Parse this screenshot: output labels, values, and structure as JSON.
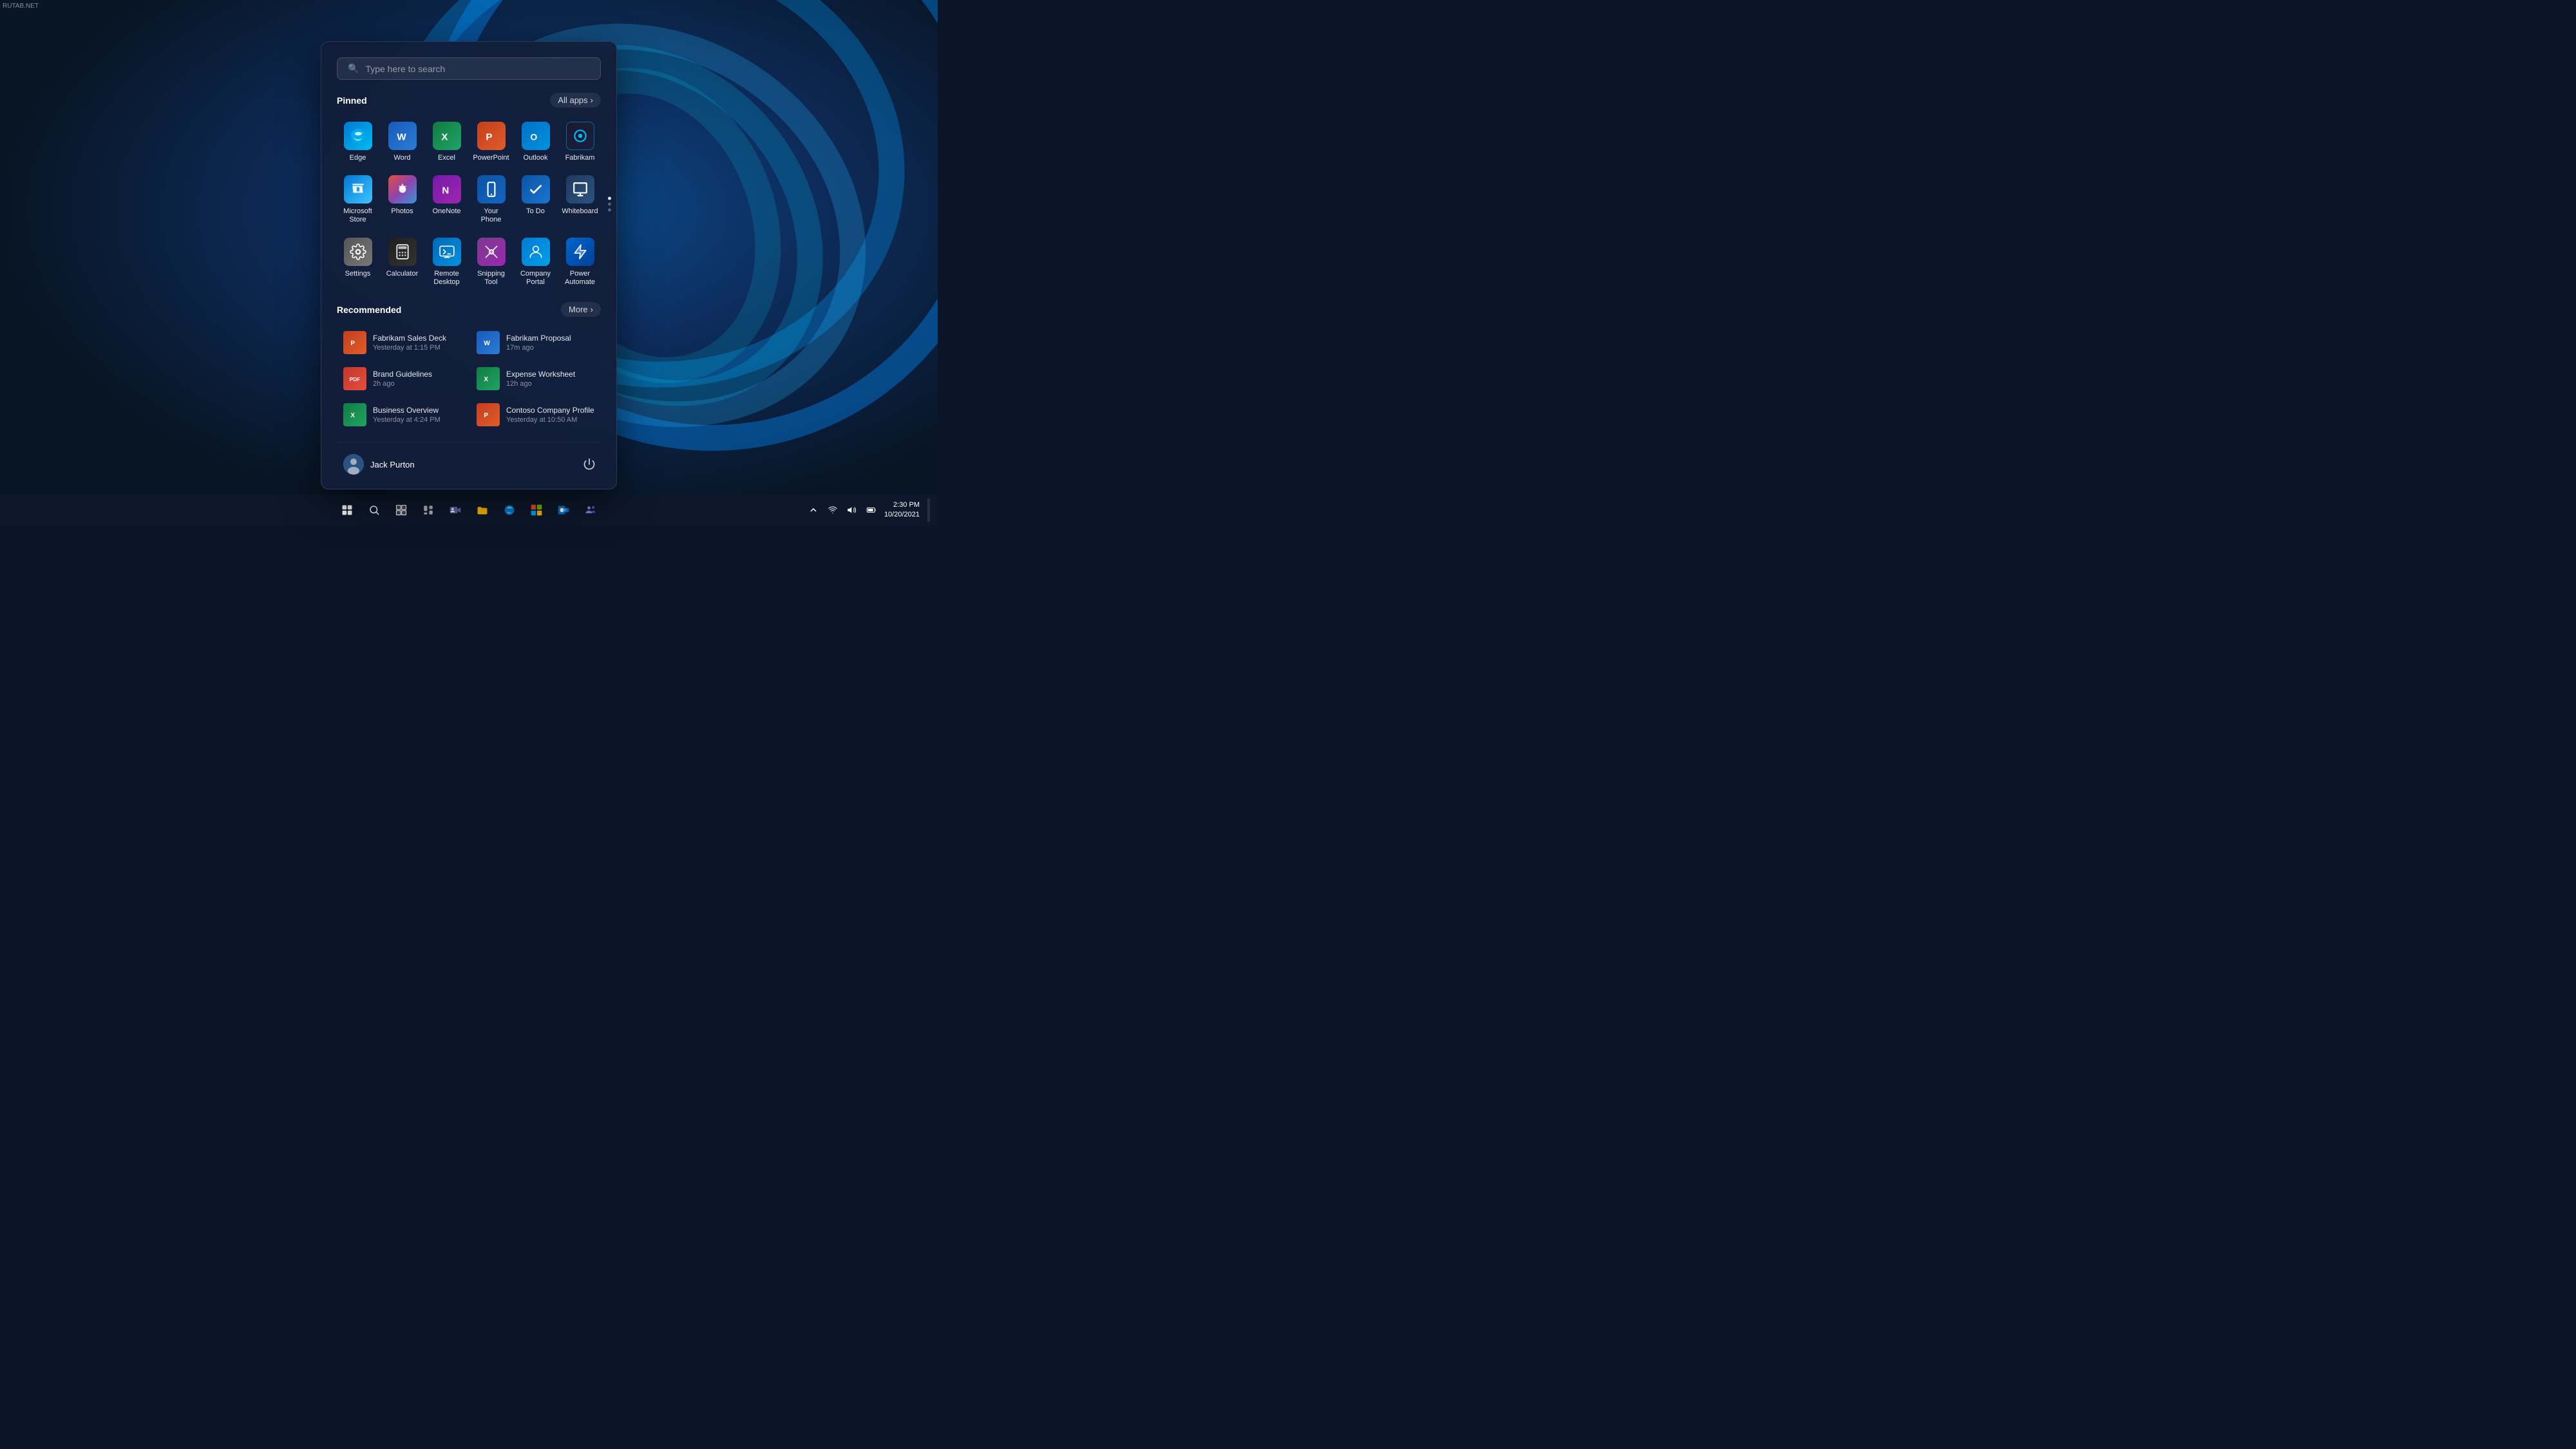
{
  "watermark": "RUTAB.NET",
  "wallpaper": {
    "description": "Windows 11 blue ribbon wallpaper"
  },
  "start_menu": {
    "search": {
      "placeholder": "Type here to search"
    },
    "pinned": {
      "label": "Pinned",
      "all_apps_label": "All apps",
      "apps": [
        {
          "id": "edge",
          "label": "Edge",
          "icon_type": "edge"
        },
        {
          "id": "word",
          "label": "Word",
          "icon_type": "word"
        },
        {
          "id": "excel",
          "label": "Excel",
          "icon_type": "excel"
        },
        {
          "id": "powerpoint",
          "label": "PowerPoint",
          "icon_type": "powerpoint"
        },
        {
          "id": "outlook",
          "label": "Outlook",
          "icon_type": "outlook"
        },
        {
          "id": "fabrikam",
          "label": "Fabrikam",
          "icon_type": "fabrikam"
        },
        {
          "id": "msstore",
          "label": "Microsoft Store",
          "icon_type": "store"
        },
        {
          "id": "photos",
          "label": "Photos",
          "icon_type": "photos"
        },
        {
          "id": "onenote",
          "label": "OneNote",
          "icon_type": "onenote"
        },
        {
          "id": "yourphone",
          "label": "Your Phone",
          "icon_type": "yourphone"
        },
        {
          "id": "todo",
          "label": "To Do",
          "icon_type": "todo"
        },
        {
          "id": "whiteboard",
          "label": "Whiteboard",
          "icon_type": "whiteboard"
        },
        {
          "id": "settings",
          "label": "Settings",
          "icon_type": "settings"
        },
        {
          "id": "calculator",
          "label": "Calculator",
          "icon_type": "calculator"
        },
        {
          "id": "remotedesktop",
          "label": "Remote Desktop",
          "icon_type": "remotedesktop"
        },
        {
          "id": "snipping",
          "label": "Snipping Tool",
          "icon_type": "snipping"
        },
        {
          "id": "companyportal",
          "label": "Company Portal",
          "icon_type": "companyportal"
        },
        {
          "id": "powerautomate",
          "label": "Power Automate",
          "icon_type": "powerautomate"
        }
      ]
    },
    "recommended": {
      "label": "Recommended",
      "more_label": "More",
      "items": [
        {
          "id": "fabrikam-sales",
          "name": "Fabrikam Sales Deck",
          "time": "Yesterday at 1:15 PM",
          "icon_type": "pptx"
        },
        {
          "id": "fabrikam-proposal",
          "name": "Fabrikam Proposal",
          "time": "17m ago",
          "icon_type": "word"
        },
        {
          "id": "brand-guidelines",
          "name": "Brand Guidelines",
          "time": "2h ago",
          "icon_type": "pdf"
        },
        {
          "id": "expense-worksheet",
          "name": "Expense Worksheet",
          "time": "12h ago",
          "icon_type": "excel"
        },
        {
          "id": "business-overview",
          "name": "Business Overview",
          "time": "Yesterday at 4:24 PM",
          "icon_type": "excel"
        },
        {
          "id": "contoso-profile",
          "name": "Contoso Company Profile",
          "time": "Yesterday at 10:50 AM",
          "icon_type": "pptx"
        }
      ]
    },
    "footer": {
      "user_name": "Jack Purton",
      "power_icon": "⏻"
    }
  },
  "taskbar": {
    "center_icons": [
      {
        "id": "start",
        "icon": "⊞",
        "label": "Start"
      },
      {
        "id": "search",
        "icon": "🔍",
        "label": "Search"
      },
      {
        "id": "taskview",
        "icon": "❑",
        "label": "Task View"
      },
      {
        "id": "widgets",
        "icon": "▦",
        "label": "Widgets"
      },
      {
        "id": "teams",
        "icon": "📹",
        "label": "Meet"
      },
      {
        "id": "explorer",
        "icon": "📁",
        "label": "File Explorer"
      },
      {
        "id": "edge",
        "icon": "🌐",
        "label": "Edge"
      },
      {
        "id": "store",
        "icon": "🛍",
        "label": "Store"
      },
      {
        "id": "outlook",
        "icon": "📧",
        "label": "Outlook"
      },
      {
        "id": "teams2",
        "icon": "💬",
        "label": "Teams"
      }
    ],
    "system_tray": {
      "time": "2:30 PM",
      "date": "10/20/2021"
    }
  }
}
